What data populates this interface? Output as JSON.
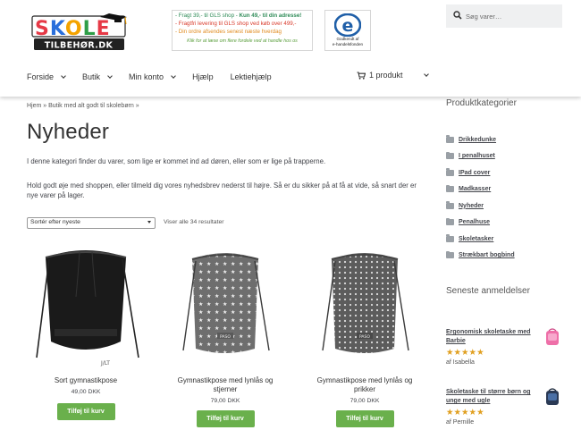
{
  "header": {
    "logo_main": "SKOLE",
    "logo_sub": "TILBEHØR.DK",
    "promo": {
      "line1_prefix": "- Fragt 39,- til GLS shop - ",
      "line1_bold": "Kun 49,- til din adresse!",
      "line2": "- Fragtfri levering til GLS shop ved køb over 499,-",
      "line3": "- Din ordre afsendes senest næste hverdag",
      "line4": "Klik for at læse om flere fordele ved at handle hos os"
    },
    "trust": {
      "line1": "Godkendt af",
      "line2": "e-handelsfonden"
    },
    "search_placeholder": "Søg varer…"
  },
  "nav": {
    "items": [
      "Forside",
      "Butik",
      "Min konto",
      "Hjælp",
      "Lektiehjælp"
    ],
    "cart_label": "1 produkt"
  },
  "breadcrumb": "Hjem » Butik med alt godt til skolebørn »",
  "title": "Nyheder",
  "description": [
    "I denne kategori finder du varer, som lige er kommet ind ad døren, eller som er lige på trapperne.",
    "Hold godt øje med shoppen, eller tilmeld dig vores nyhedsbrev nederst til højre. Så er du sikker på at få at vide, så snart der er nye varer på lager."
  ],
  "sort": {
    "selected": "Sortér efter nyeste",
    "result_count": "Viser alle 34 resultater"
  },
  "products": [
    {
      "name": "Sort gymnastikpose",
      "price": "49,00 DKK",
      "button": "Tilføj til kurv",
      "print": "J/LT"
    },
    {
      "name": "Gymnastikpose med lynlås og stjerner",
      "price": "79,00 DKK",
      "button": "Tilføj til kurv",
      "print": "PASO"
    },
    {
      "name": "Gymnastikpose med lynlås og prikker",
      "price": "79,00 DKK",
      "button": "Tilføj til kurv",
      "print": "PASO"
    }
  ],
  "sidebar": {
    "categories_title": "Produktkategorier",
    "categories": [
      "Drikkedunke",
      "I penalhuset",
      "IPad cover",
      "Madkasser",
      "Nyheder",
      "Penalhuse",
      "Skoletasker",
      "Strækbart bogbind"
    ],
    "reviews_title": "Seneste anmeldelser",
    "reviews": [
      {
        "title": "Ergonomisk skoletaske med Barbie",
        "stars": "★★★★★",
        "author": "af Isabella"
      },
      {
        "title": "Skoletaske til større børn og unge med ugle",
        "stars": "★★★★★",
        "author": "af Pernille"
      }
    ]
  },
  "colors": {
    "button_green": "#6ab04c",
    "star_gold": "#e09f1f",
    "promo_green": "#2e8b57",
    "promo_red": "#d93a2b",
    "promo_orange": "#e08a1e",
    "search_bg": "#eff0f1"
  },
  "icons": {
    "search": "search-icon",
    "cart": "cart-icon",
    "folder": "folder-icon",
    "chevron": "chevron-down-icon"
  }
}
